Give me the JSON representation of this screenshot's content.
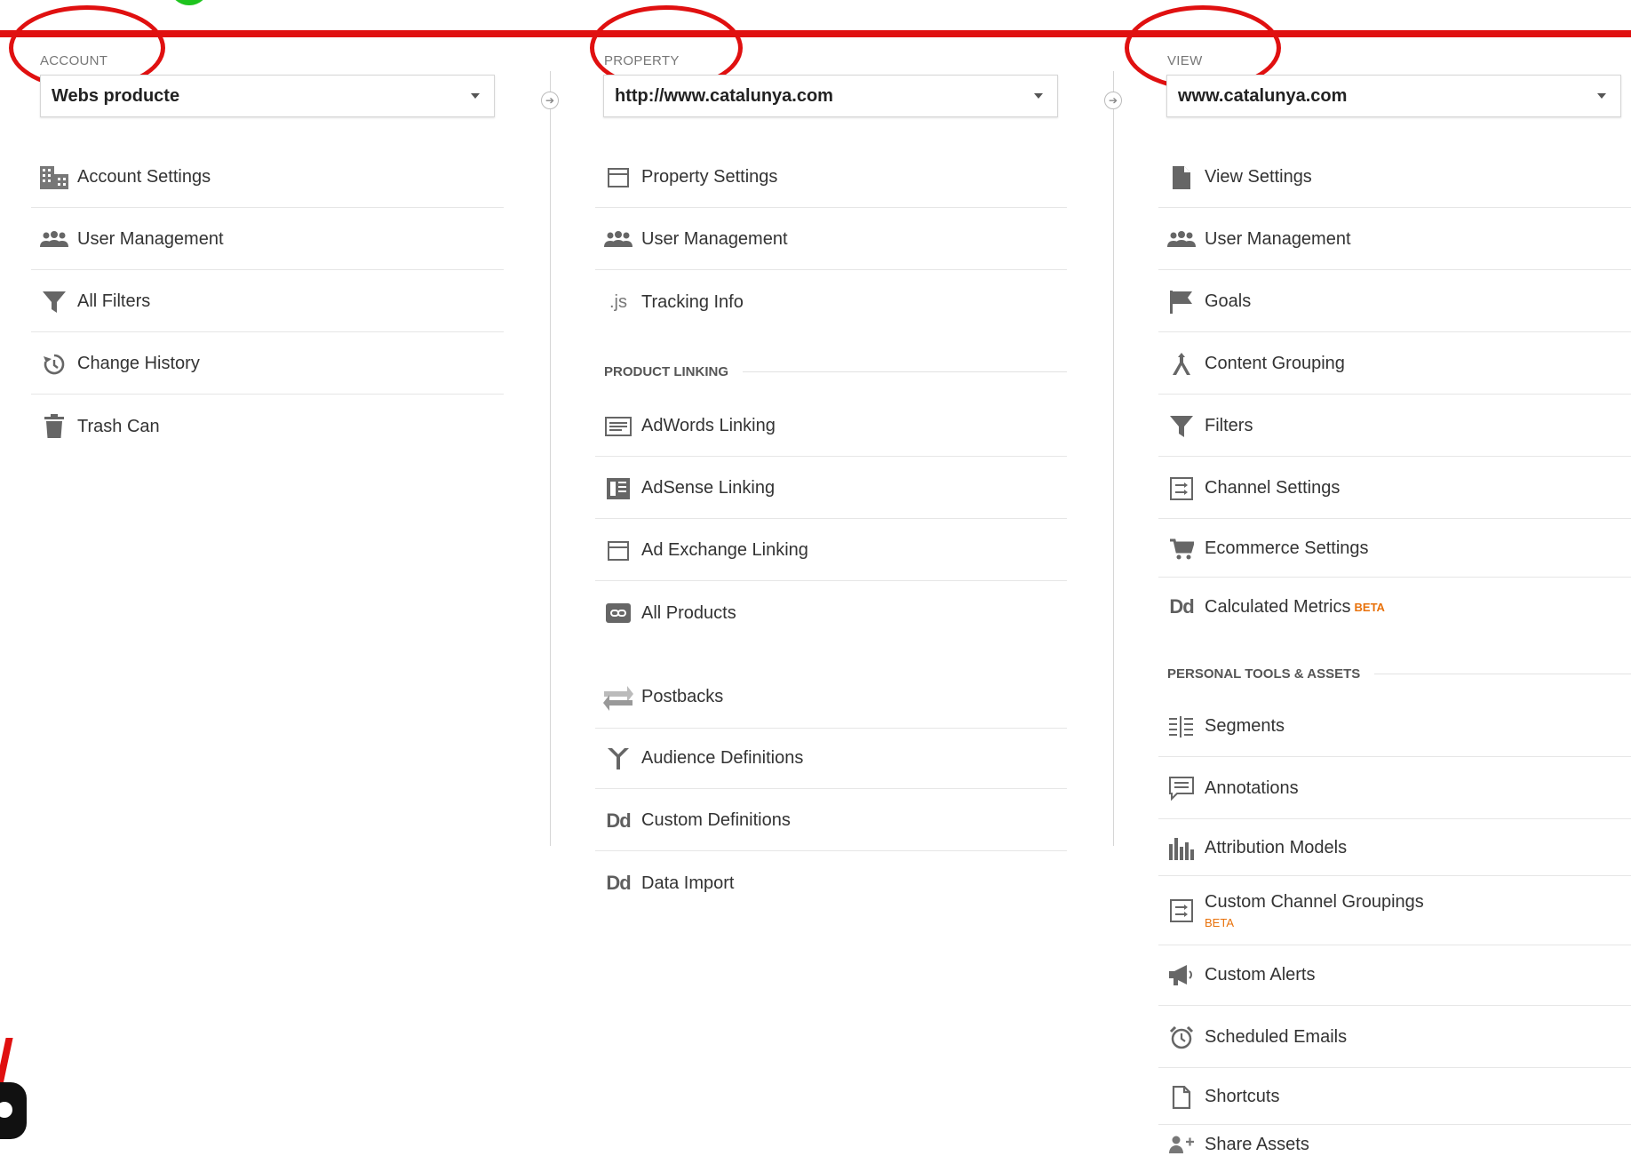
{
  "account": {
    "label": "ACCOUNT",
    "selected": "Webs producte",
    "items": [
      {
        "label": "Account Settings",
        "icon": "building-icon"
      },
      {
        "label": "User Management",
        "icon": "people-icon"
      },
      {
        "label": "All Filters",
        "icon": "filter-icon"
      },
      {
        "label": "Change History",
        "icon": "history-icon"
      },
      {
        "label": "Trash Can",
        "icon": "trash-icon"
      }
    ]
  },
  "property": {
    "label": "PROPERTY",
    "selected": "http://www.catalunya.com",
    "items": [
      {
        "label": "Property Settings",
        "icon": "window-icon"
      },
      {
        "label": "User Management",
        "icon": "people-icon"
      },
      {
        "label": "Tracking Info",
        "icon": "js-icon",
        "glyph": ".js"
      }
    ],
    "product_linking_heading": "PRODUCT LINKING",
    "linking_items": [
      {
        "label": "AdWords Linking",
        "icon": "adwords-icon"
      },
      {
        "label": "AdSense Linking",
        "icon": "adsense-icon"
      },
      {
        "label": "Ad Exchange Linking",
        "icon": "window-icon"
      },
      {
        "label": "All Products",
        "icon": "link-icon"
      }
    ],
    "more_items": [
      {
        "label": "Postbacks",
        "icon": "postbacks-icon"
      },
      {
        "label": "Audience Definitions",
        "icon": "audience-icon"
      },
      {
        "label": "Custom Definitions",
        "icon": "dd-icon",
        "glyph": "Dd"
      },
      {
        "label": "Data Import",
        "icon": "dd-icon",
        "glyph": "Dd"
      }
    ]
  },
  "view": {
    "label": "VIEW",
    "selected": "www.catalunya.com",
    "items": [
      {
        "label": "View Settings",
        "icon": "document-icon"
      },
      {
        "label": "User Management",
        "icon": "people-icon"
      },
      {
        "label": "Goals",
        "icon": "flag-icon"
      },
      {
        "label": "Content Grouping",
        "icon": "content-grouping-icon"
      },
      {
        "label": "Filters",
        "icon": "filter-icon"
      },
      {
        "label": "Channel Settings",
        "icon": "channel-icon"
      },
      {
        "label": "Ecommerce Settings",
        "icon": "cart-icon"
      },
      {
        "label": "Calculated Metrics",
        "icon": "dd-icon",
        "glyph": "Dd",
        "badge": "BETA"
      }
    ],
    "personal_heading": "PERSONAL TOOLS & ASSETS",
    "personal_items": [
      {
        "label": "Segments",
        "icon": "segments-icon"
      },
      {
        "label": "Annotations",
        "icon": "annotation-icon"
      },
      {
        "label": "Attribution Models",
        "icon": "attribution-icon"
      },
      {
        "label": "Custom Channel Groupings",
        "icon": "channel-icon",
        "badge": "BETA"
      },
      {
        "label": "Custom Alerts",
        "icon": "megaphone-icon"
      },
      {
        "label": "Scheduled Emails",
        "icon": "alarm-clock-icon"
      },
      {
        "label": "Shortcuts",
        "icon": "shortcut-icon"
      },
      {
        "label": "Share Assets",
        "icon": "share-user-icon"
      }
    ]
  },
  "colors": {
    "annotation_red": "#e01010",
    "annotation_green": "#1ec41e",
    "beta_orange": "#e8710a"
  }
}
